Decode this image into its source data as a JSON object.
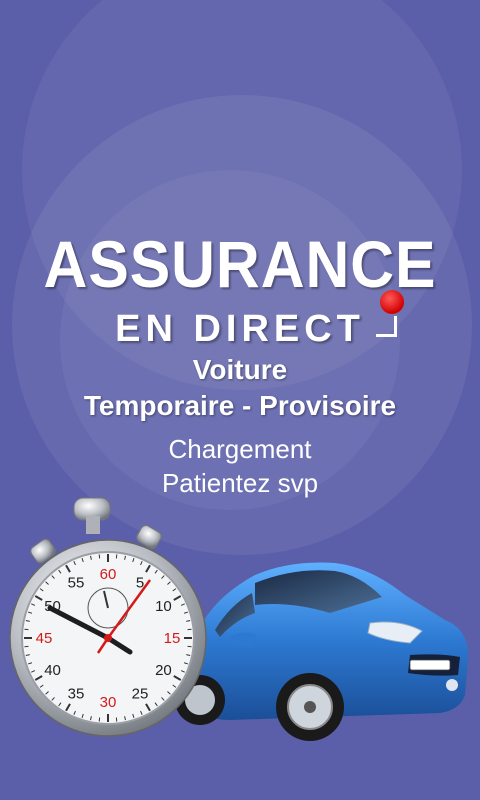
{
  "logo": {
    "line1": "ASSURANCE",
    "line2": "EN DIRECT"
  },
  "subtitle": {
    "line1": "Voiture",
    "line2": "Temporaire - Provisoire"
  },
  "loading": {
    "line1": "Chargement",
    "line2": "Patientez svp"
  },
  "stopwatch": {
    "numbers": [
      {
        "t": "60",
        "red": true
      },
      {
        "t": "5",
        "red": false
      },
      {
        "t": "10",
        "red": false
      },
      {
        "t": "15",
        "red": true
      },
      {
        "t": "20",
        "red": false
      },
      {
        "t": "25",
        "red": false
      },
      {
        "t": "30",
        "red": true
      },
      {
        "t": "35",
        "red": false
      },
      {
        "t": "40",
        "red": false
      },
      {
        "t": "45",
        "red": true
      },
      {
        "t": "50",
        "red": false
      },
      {
        "t": "55",
        "red": false
      }
    ]
  },
  "colors": {
    "background": "#5b5ea8",
    "accent_red": "#d10000",
    "car_body": "#2f7fd6"
  }
}
